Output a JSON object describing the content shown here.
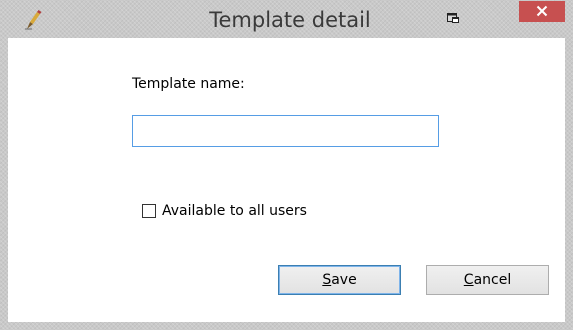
{
  "window": {
    "title": "Template detail"
  },
  "form": {
    "name_label": "Template name:",
    "name_value": "",
    "name_placeholder": "",
    "available_label": "Available to all users",
    "available_checked": false
  },
  "buttons": {
    "save_accel": "S",
    "save_rest": "ave",
    "cancel_accel": "C",
    "cancel_rest": "ancel"
  },
  "icons": {
    "app": "pen-icon",
    "restore": "window-restore-icon",
    "close": "close-icon"
  },
  "colors": {
    "close_button": "#c75050",
    "input_border": "#569de5",
    "default_button_border": "#3c7fb1"
  }
}
